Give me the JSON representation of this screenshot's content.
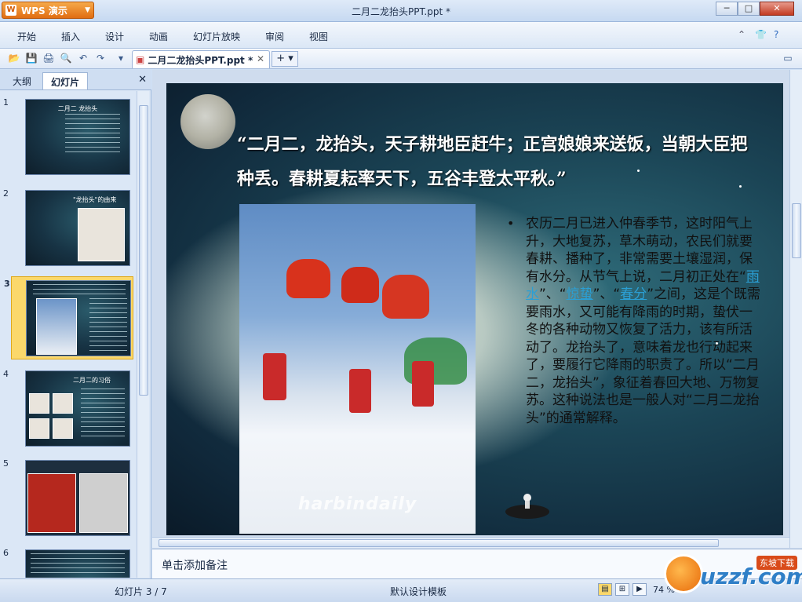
{
  "app": {
    "name": "WPS 演示",
    "window_title": "二月二龙抬头PPT.ppt *"
  },
  "menu": [
    "开始",
    "插入",
    "设计",
    "动画",
    "幻灯片放映",
    "审阅",
    "视图"
  ],
  "toolbar": {
    "doc_tab": "二月二龙抬头PPT.ppt *",
    "add_tab": "+"
  },
  "left_panel": {
    "tabs": [
      "大纲",
      "幻灯片"
    ],
    "thumbnails": [
      {
        "num": "1",
        "title": "二月二 龙抬头"
      },
      {
        "num": "2",
        "title": "\"龙抬头\"的由来"
      },
      {
        "num": "3",
        "title": ""
      },
      {
        "num": "4",
        "title": "二月二的习俗"
      },
      {
        "num": "5",
        "title": ""
      },
      {
        "num": "6",
        "title": ""
      }
    ]
  },
  "slide": {
    "quote": "“二月二，龙抬头，天子耕地臣赶牛；正宫娘娘来送饭，当朝大臣把种丢。春耕夏耘率天下，五谷丰登太平秋。”",
    "photo_watermark": "harbindaily",
    "body_before": "农历二月已进入仲春季节，这时阳气上升，大地复苏，草木萌动，农民们就要春耕、播种了，非常需要土壤湿润，保有水分。从节气上说，二月初正处在“",
    "term1": "雨水",
    "sep1": "”、“",
    "term2": "惊蛰",
    "sep2": "”、“",
    "term3": "春分",
    "body_after": "”之间，这是个既需要雨水，又可能有降雨的时期，蛰伏一冬的各种动物又恢复了活力，该有所活动了。龙抬头了，意味着龙也行动起来了，要履行它降雨的职责了。所以“二月二，龙抬头”，象征着春回大地、万物复苏。这种说法也是一般人对“二月二龙抬头”的通常解释。"
  },
  "notes": {
    "placeholder": "单击添加备注"
  },
  "status": {
    "slide_counter": "幻灯片 3 / 7",
    "template": "默认设计模板",
    "zoom": "74 %"
  },
  "brand": {
    "name": "uzzf.com",
    "tag": "东坡下载"
  }
}
